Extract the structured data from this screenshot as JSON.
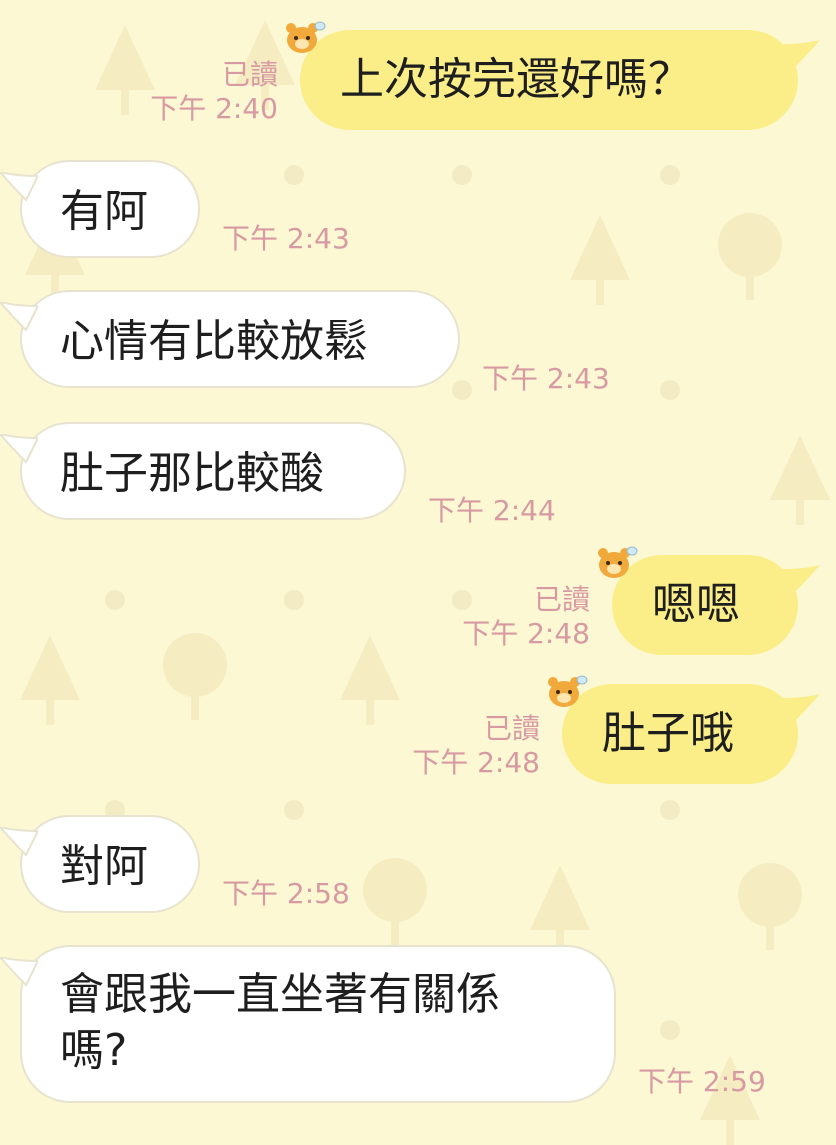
{
  "chat": {
    "messages": [
      {
        "dir": "out",
        "text": "上次按完還好嗎？",
        "read": "已讀",
        "time": "下午 2:40"
      },
      {
        "dir": "in",
        "text": "有阿",
        "time": "下午 2:43"
      },
      {
        "dir": "in",
        "text": "心情有比較放鬆",
        "time": "下午 2:43"
      },
      {
        "dir": "in",
        "text": "肚子那比較酸",
        "time": "下午 2:44"
      },
      {
        "dir": "out",
        "text": "嗯嗯",
        "read": "已讀",
        "time": "下午 2:48"
      },
      {
        "dir": "out",
        "text": "肚子哦",
        "read": "已讀",
        "time": "下午 2:48"
      },
      {
        "dir": "in",
        "text": "對阿",
        "time": "下午 2:58"
      },
      {
        "dir": "in",
        "text": "會跟我一直坐著有關係",
        "text2": "嗎?",
        "time": "下午 2:59"
      }
    ]
  },
  "colors": {
    "background": "#fcf8d4",
    "outgoing_bubble": "#fbee88",
    "incoming_bubble": "#ffffff",
    "timestamp": "#d79aa2"
  },
  "icons": {
    "sticker": "bee-bear-sticker-icon",
    "wallpaper": "tree-pattern"
  }
}
